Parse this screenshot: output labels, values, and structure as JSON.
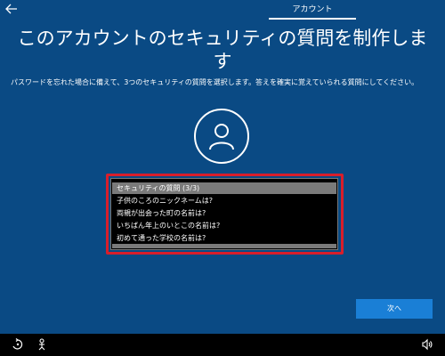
{
  "header": {
    "tab_label": "アカウント",
    "back_icon": "back-arrow-icon"
  },
  "main": {
    "title_line1": "このアカウントのセキュリティの質問を制作しま",
    "title_line2": "す",
    "subtitle": "パスワードを忘れた場合に備えて、3つのセキュリティの質問を選択します。答えを確実に覚えていられる質問にしてください。",
    "avatar_icon": "user-icon"
  },
  "dropdown": {
    "options": [
      "セキュリティの質問 (3/3)",
      "子供のころのニックネームは?",
      "両親が出会った町の名前は?",
      "いちばん年上のいとこの名前は?",
      "初めて通った学校の名前は?"
    ],
    "selected_index": 0
  },
  "footer": {
    "next_label": "次へ"
  },
  "taskbar": {
    "left_icons": [
      "ease-of-access-icon",
      "accessibility-person-icon"
    ],
    "right_icons": [
      "volume-icon"
    ]
  },
  "colors": {
    "background": "#0a4a84",
    "highlight_border": "#d81e2b",
    "button": "#1a7fd6",
    "selected_option": "#7a7a7a"
  }
}
